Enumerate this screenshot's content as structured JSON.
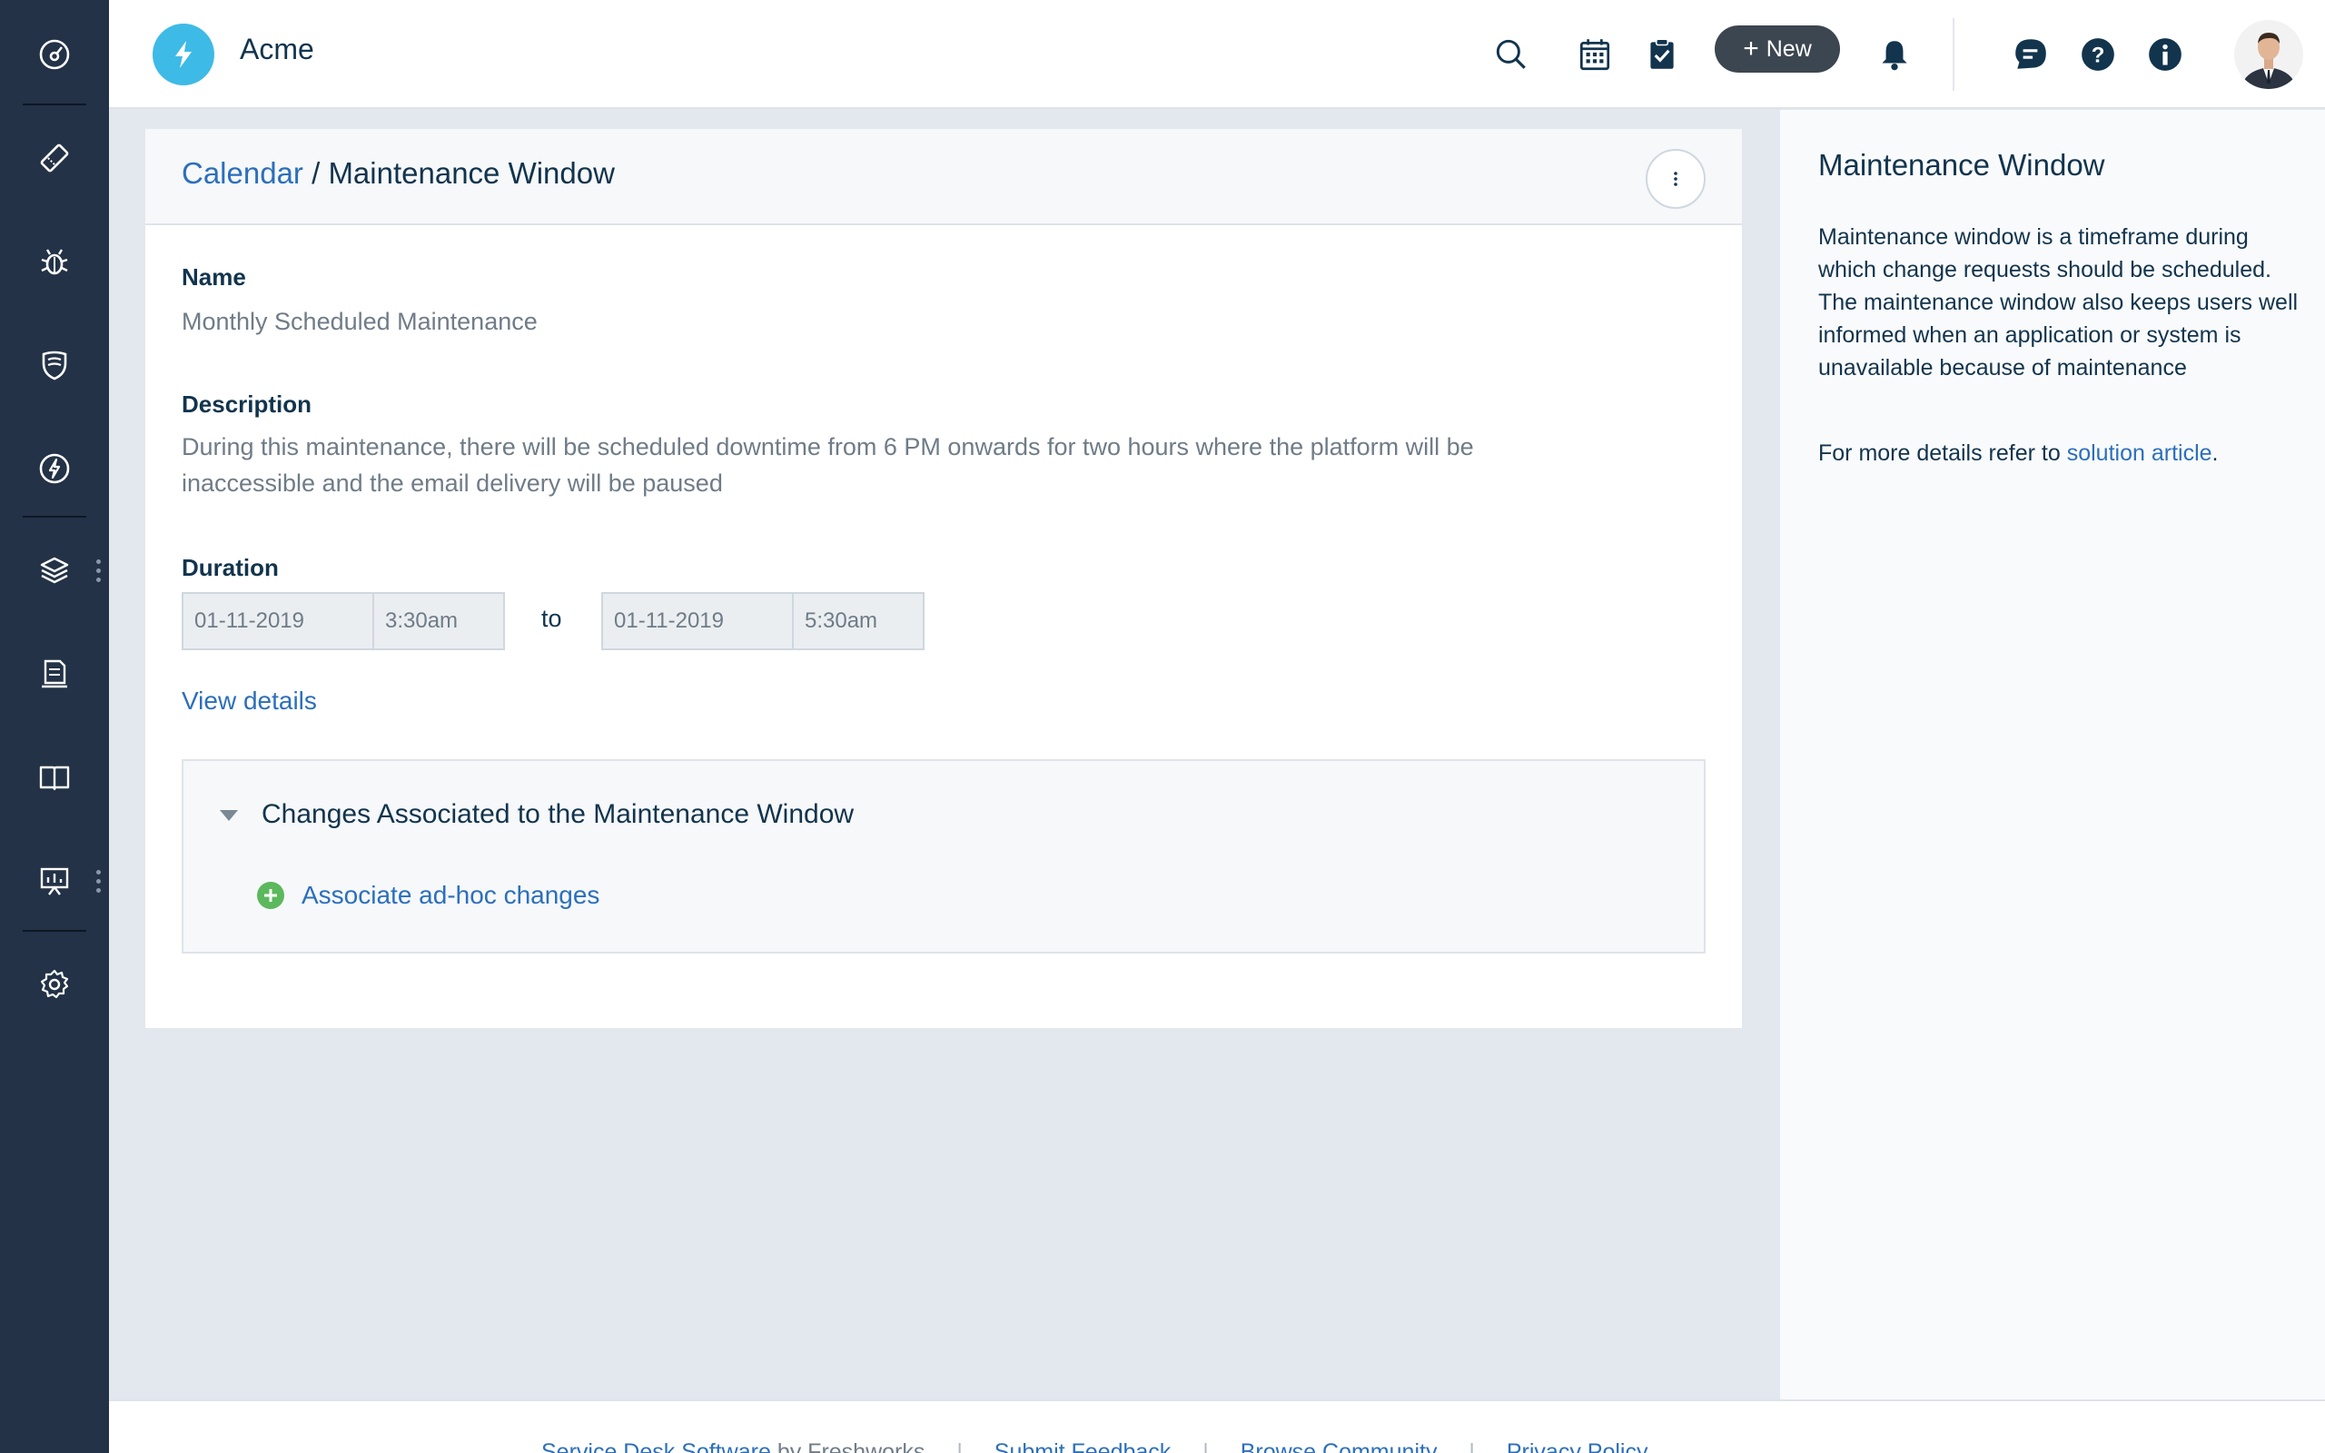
{
  "app": {
    "name": "Acme"
  },
  "header": {
    "new_label": "New"
  },
  "breadcrumb": {
    "parent": "Calendar",
    "separator": "/",
    "current": "Maintenance Window"
  },
  "form": {
    "name_label": "Name",
    "name_value": "Monthly Scheduled Maintenance",
    "description_label": "Description",
    "description_line1": "During this maintenance, there will be scheduled downtime from 6 PM onwards for two hours where the platform will be",
    "description_line2": "inaccessible and the email delivery will be paused",
    "duration_label": "Duration",
    "start_date": "01-11-2019",
    "start_time": "3:30am",
    "to_label": "to",
    "end_date": "01-11-2019",
    "end_time": "5:30am",
    "view_details": "View details"
  },
  "changes": {
    "title": "Changes Associated to the Maintenance Window",
    "associate_label": "Associate ad-hoc changes"
  },
  "right_panel": {
    "title": "Maintenance Window",
    "body": "Maintenance window is a timeframe during which change requests should be scheduled. The maintenance window also keeps users well informed when an application or system is unavailable because of maintenance",
    "more_prefix": "For more details refer to ",
    "more_link": "solution article",
    "more_suffix": "."
  },
  "footer": {
    "link1": "Service Desk Software",
    "by_text": " by Freshworks",
    "link2": "Submit Feedback",
    "link3": "Browse Community",
    "link4": "Privacy Policy",
    "separator": "|"
  },
  "colors": {
    "sidebar": "#233246",
    "accent": "#2c6fbb",
    "logo": "#3ebae6",
    "add": "#5cb85c"
  },
  "icons": {
    "sidebar": [
      "dashboard-icon",
      "ticket-icon",
      "bug-icon",
      "shield-icon",
      "lightning-icon",
      "layers-icon",
      "document-icon",
      "book-icon",
      "presentation-icon",
      "gear-icon"
    ],
    "header": [
      "search-icon",
      "calendar-icon",
      "todo-icon",
      "plus-icon",
      "bell-icon",
      "chat-icon",
      "help-icon",
      "info-icon"
    ]
  }
}
